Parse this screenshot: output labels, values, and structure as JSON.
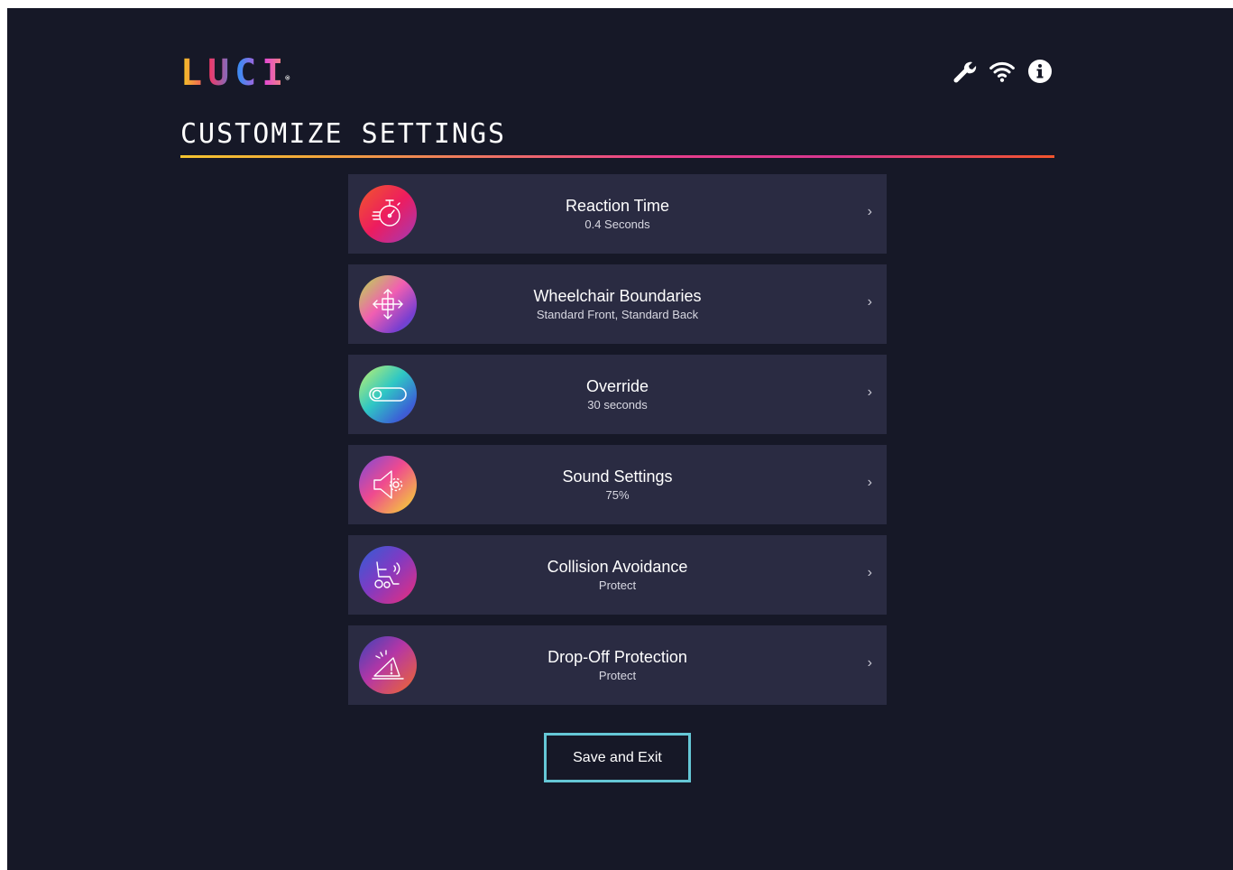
{
  "app": {
    "logo_text": "LUCI",
    "logo_mark": "®",
    "status_icons": [
      "wrench-icon",
      "wifi-icon",
      "info-icon"
    ]
  },
  "page": {
    "title": "CUSTOMIZE SETTINGS"
  },
  "settings": [
    {
      "title": "Reaction Time",
      "value": "0.4 Seconds",
      "icon": "stopwatch-icon"
    },
    {
      "title": "Wheelchair Boundaries",
      "value": "Standard Front, Standard Back",
      "icon": "move-arrows-icon"
    },
    {
      "title": "Override",
      "value": "30 seconds",
      "icon": "toggle-icon"
    },
    {
      "title": "Sound Settings",
      "value": "75%",
      "icon": "speaker-gear-icon"
    },
    {
      "title": "Collision Avoidance",
      "value": "Protect",
      "icon": "wheelchair-signal-icon"
    },
    {
      "title": "Drop-Off Protection",
      "value": "Protect",
      "icon": "drop-off-warning-icon"
    }
  ],
  "chevron": "›",
  "actions": {
    "save_label": "Save and Exit"
  },
  "colors": {
    "background": "#161827",
    "row_background": "#2a2b42",
    "button_border": "#65c7d6"
  }
}
